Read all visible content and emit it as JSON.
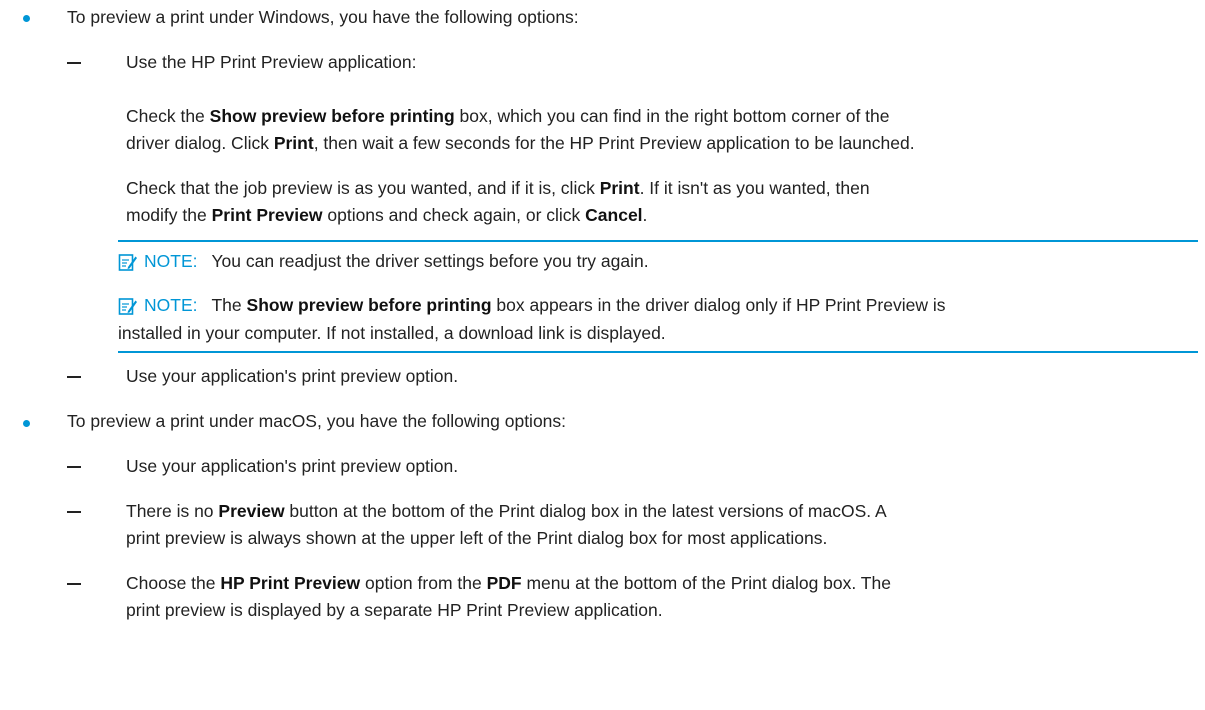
{
  "content": {
    "windows_intro": "To preview a print under Windows, you have the following options:",
    "hp_preview_item": "Use the HP Print Preview application:",
    "para1": {
      "line1_a": "Check the ",
      "line1_b": "Show preview before printing",
      "line1_c": " box, which you can find in the right bottom corner of the",
      "line2_a": "driver dialog. Click ",
      "line2_b": "Print",
      "line2_c": ", then wait a few seconds for the HP Print Preview application to be launched."
    },
    "para2": {
      "line1_a": "Check that the job preview is as you wanted, and if it is, click ",
      "line1_b": "Print",
      "line1_c": ". If it isn't as you wanted, then",
      "line2_a": "modify the ",
      "line2_b": "Print Preview",
      "line2_c": " options and check again, or click ",
      "line2_d": "Cancel",
      "line2_e": "."
    },
    "note1": {
      "label": "NOTE:",
      "text": "You can readjust the driver settings before you try again."
    },
    "note2": {
      "label": "NOTE:",
      "line1_a": "The ",
      "line1_b": "Show preview before printing",
      "line1_c": " box appears in the driver dialog only if HP Print Preview is",
      "line2": "installed in your computer. If not installed, a download link is displayed."
    },
    "windows_app_option": "Use your application's print preview option.",
    "macos_intro": "To preview a print under macOS, you have the following options:",
    "macos_app_option": "Use your application's print preview option.",
    "macos_item2": {
      "line1_a": "There is no ",
      "line1_b": "Preview",
      "line1_c": " button at the bottom of the Print dialog box in the latest versions of macOS. A",
      "line2": "print preview is always shown at the upper left of the Print dialog box for most applications."
    },
    "macos_item3": {
      "line1_a": "Choose the ",
      "line1_b": "HP Print Preview",
      "line1_c": " option from the ",
      "line1_d": "PDF",
      "line1_e": " menu at the bottom of the Print dialog box. The",
      "line2": "print preview is displayed by a separate HP Print Preview application."
    }
  },
  "colors": {
    "accent": "#0096d6",
    "text": "#222222"
  },
  "icons": {
    "note": "note-pencil-icon"
  }
}
